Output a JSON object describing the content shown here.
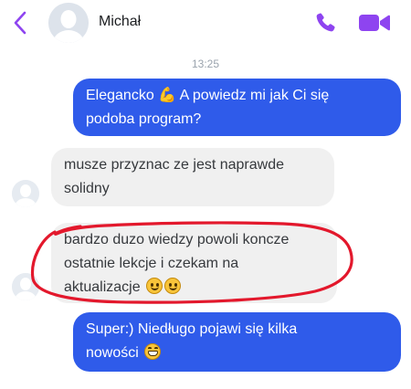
{
  "colors": {
    "accent": "#8e44f0",
    "outgoing_bubble": "#2f5bea",
    "incoming_bubble": "#f0f0f0",
    "annotation": "#e3182c"
  },
  "header": {
    "contact_name": "Michał",
    "icons": [
      "chevron-left-icon",
      "avatar-placeholder-icon",
      "phone-icon",
      "video-camera-icon"
    ]
  },
  "conversation": {
    "timestamp": "13:25",
    "messages": [
      {
        "direction": "outgoing",
        "text": "Elegancko 💪 A powiedz mi jak Ci się podoba program?"
      },
      {
        "direction": "incoming",
        "text": "musze przyznac ze jest naprawde solidny"
      },
      {
        "direction": "incoming",
        "text": "bardzo duzo wiedzy powoli koncze ostatnie lekcje i czekam na aktualizacje 🙂🙂"
      },
      {
        "direction": "outgoing",
        "text": "Super:) Niedługo pojawi się kilka nowości 😁"
      }
    ]
  },
  "lines": {
    "m1_l1": "Elegancko",
    "m1_l1b": "A powiedz mi jak Ci się",
    "m1_l2": "podoba program?",
    "m2_l1": "musze przyznac ze jest naprawde",
    "m2_l2": "solidny",
    "m3_l1": "bardzo duzo wiedzy powoli koncze",
    "m3_l2": "ostatnie lekcje i czekam na",
    "m3_l3": "aktualizacje",
    "m4_l1": "Super:) Niedługo pojawi się kilka",
    "m4_l2": "nowości"
  }
}
